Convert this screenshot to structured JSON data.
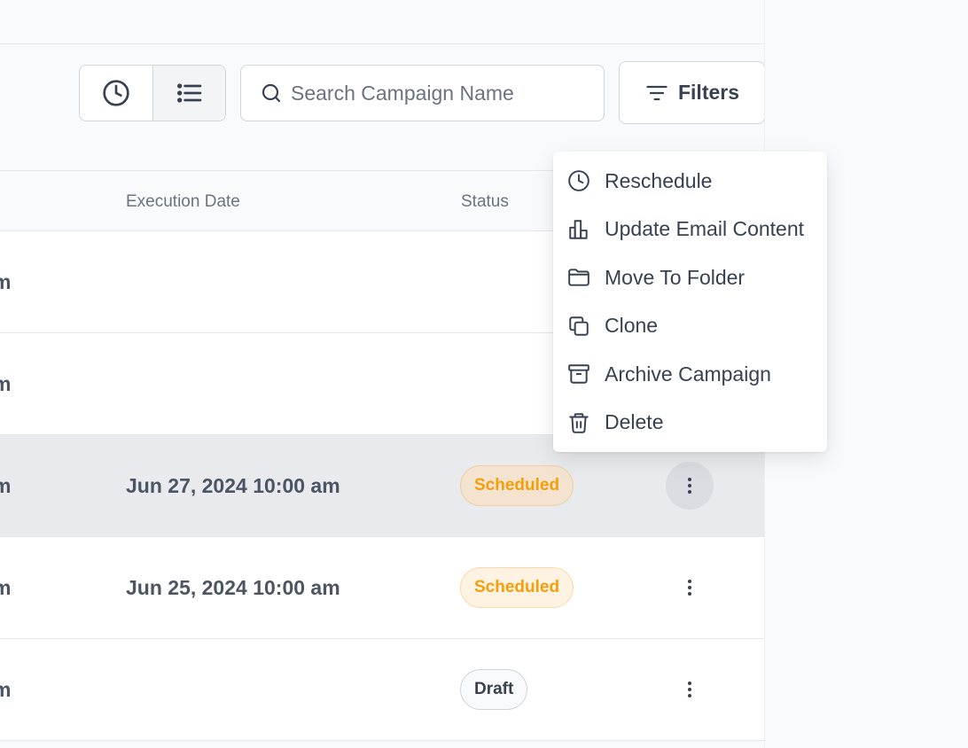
{
  "toolbar": {
    "view_toggle": {
      "calendar_icon": "clock-icon",
      "list_icon": "list-icon",
      "active": "list"
    },
    "search": {
      "placeholder": "Search Campaign Name",
      "value": ""
    },
    "filters_label": "Filters"
  },
  "table": {
    "headers": {
      "execution_date": "Execution Date",
      "status": "Status"
    },
    "rows": [
      {
        "name_fragment": "m",
        "execution_date": "",
        "status": ""
      },
      {
        "name_fragment": "m",
        "execution_date": "",
        "status": ""
      },
      {
        "name_fragment": "m",
        "execution_date": "Jun 27, 2024 10:00 am",
        "status": "Scheduled"
      },
      {
        "name_fragment": "m",
        "execution_date": "Jun 25, 2024 10:00 am",
        "status": "Scheduled"
      },
      {
        "name_fragment": "m",
        "execution_date": "",
        "status": "Draft"
      }
    ]
  },
  "context_menu": {
    "items": [
      {
        "label": "Reschedule",
        "icon": "clock-icon"
      },
      {
        "label": "Update Email Content",
        "icon": "chart-bar-icon"
      },
      {
        "label": "Move To Folder",
        "icon": "folder-icon"
      },
      {
        "label": "Clone",
        "icon": "copy-icon"
      },
      {
        "label": "Archive Campaign",
        "icon": "archive-icon"
      },
      {
        "label": "Delete",
        "icon": "trash-icon"
      }
    ]
  },
  "colors": {
    "scheduled": "#f59e0b",
    "border": "#e5e7eb",
    "text": "#374151"
  }
}
